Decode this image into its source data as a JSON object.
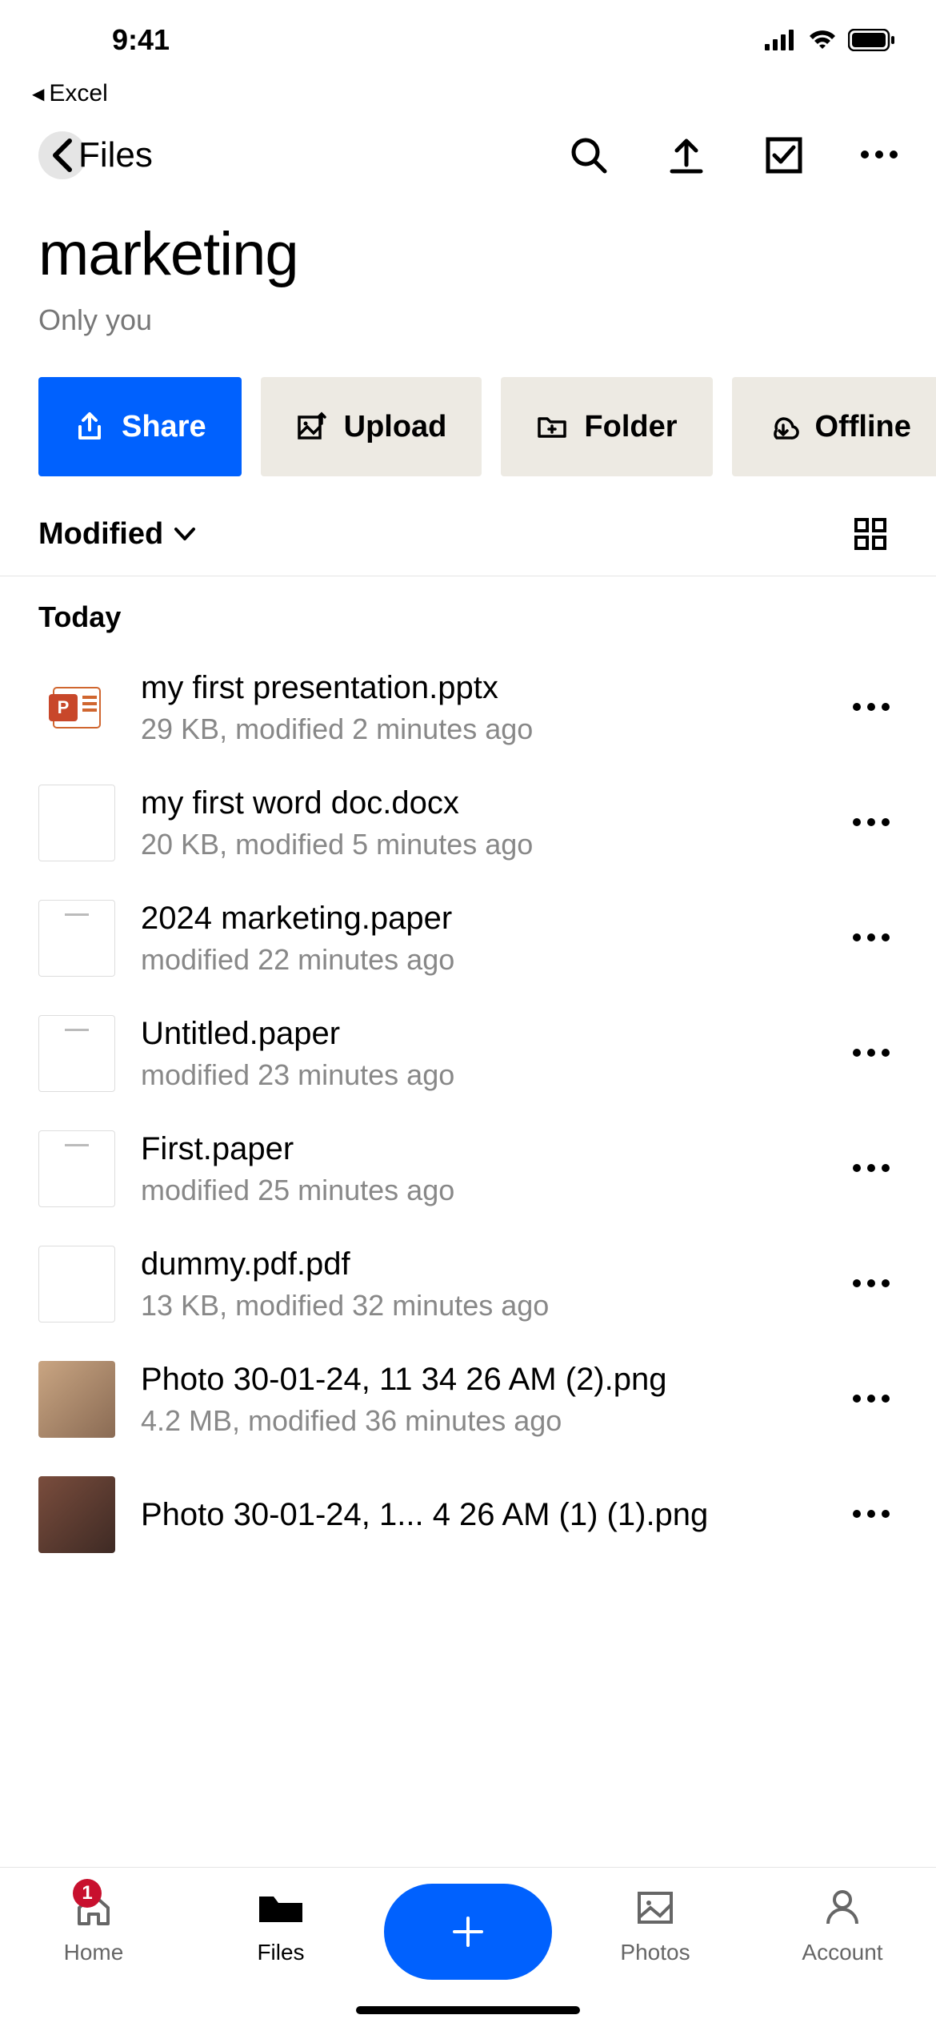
{
  "status": {
    "time": "9:41"
  },
  "breadcrumb": {
    "back_app": "Excel"
  },
  "nav": {
    "back_label": "Files"
  },
  "folder": {
    "title": "marketing",
    "subtitle": "Only you"
  },
  "actions": {
    "share": "Share",
    "upload": "Upload",
    "folder": "Folder",
    "offline": "Offline"
  },
  "sort": {
    "label": "Modified"
  },
  "section": {
    "today": "Today"
  },
  "files": [
    {
      "name": "my first presentation.pptx",
      "meta": "29 KB, modified 2 minutes ago",
      "thumb": "ppt"
    },
    {
      "name": "my first word doc.docx",
      "meta": "20 KB, modified 5 minutes ago",
      "thumb": "blank"
    },
    {
      "name": "2024 marketing.paper",
      "meta": "modified 22 minutes ago",
      "thumb": "paper"
    },
    {
      "name": "Untitled.paper",
      "meta": "modified 23 minutes ago",
      "thumb": "paper"
    },
    {
      "name": "First.paper",
      "meta": "modified 25 minutes ago",
      "thumb": "paper"
    },
    {
      "name": "dummy.pdf.pdf",
      "meta": "13 KB, modified 32 minutes ago",
      "thumb": "blank"
    },
    {
      "name": "Photo 30-01-24, 11 34 26 AM (2).png",
      "meta": "4.2 MB, modified 36 minutes ago",
      "thumb": "photo"
    },
    {
      "name": "Photo 30-01-24, 1... 4 26 AM (1) (1).png",
      "meta": "",
      "thumb": "photo2"
    }
  ],
  "tabs": {
    "home": "Home",
    "files": "Files",
    "photos": "Photos",
    "account": "Account",
    "home_badge": "1"
  }
}
